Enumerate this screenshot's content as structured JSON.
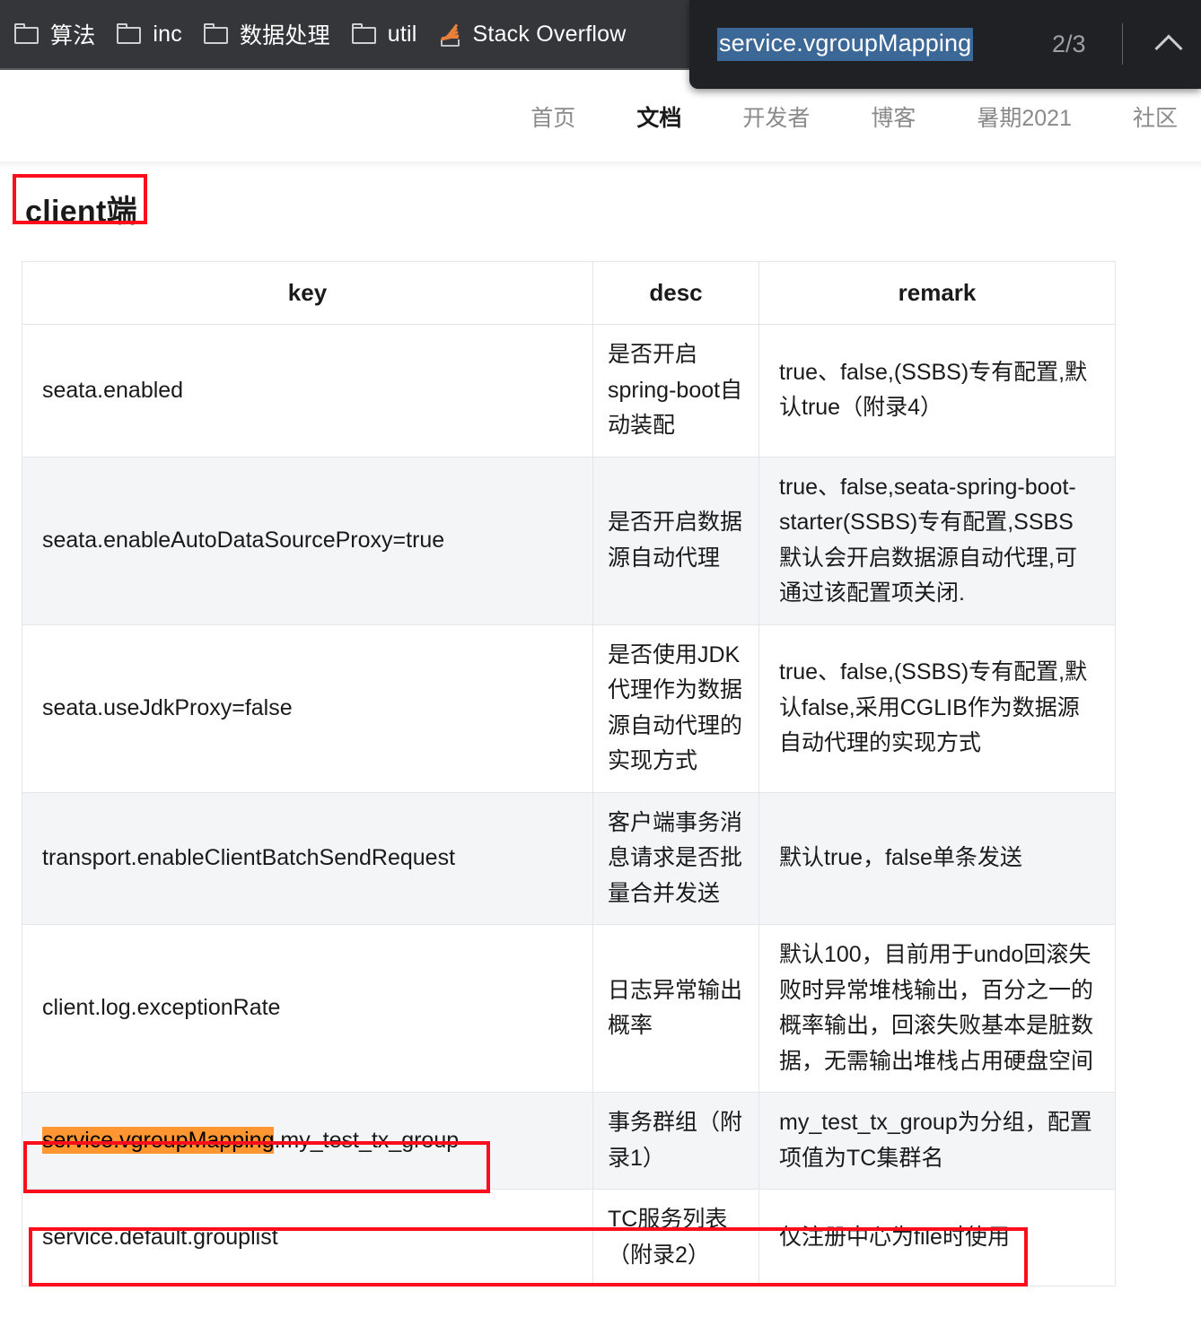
{
  "browser": {
    "bookmarks": [
      {
        "icon": "folder-icon",
        "label": "算法"
      },
      {
        "icon": "folder-icon",
        "label": "inc"
      },
      {
        "icon": "folder-icon",
        "label": "数据处理"
      },
      {
        "icon": "folder-icon",
        "label": "util"
      },
      {
        "icon": "stack-overflow-icon",
        "label": "Stack Overflow"
      }
    ],
    "find_bar": {
      "query": "service.vgroupMapping",
      "match_count": "2/3",
      "prev_icon": "chevron-up-icon"
    }
  },
  "site_nav": {
    "items": [
      {
        "label": "首页",
        "active": false
      },
      {
        "label": "文档",
        "active": true
      },
      {
        "label": "开发者",
        "active": false
      },
      {
        "label": "博客",
        "active": false
      },
      {
        "label": "暑期2021",
        "active": false
      },
      {
        "label": "社区",
        "active": false
      }
    ]
  },
  "page": {
    "heading": "client端",
    "table": {
      "headers": [
        "key",
        "desc",
        "remark"
      ],
      "rows": [
        {
          "key": "seata.enabled",
          "desc": "是否开启spring-boot自动装配",
          "remark": "true、false,(SSBS)专有配置,默认true（附录4）"
        },
        {
          "key": "seata.enableAutoDataSourceProxy=true",
          "desc": "是否开启数据源自动代理",
          "remark": "true、false,seata-spring-boot-starter(SSBS)专有配置,SSBS默认会开启数据源自动代理,可通过该配置项关闭."
        },
        {
          "key": "seata.useJdkProxy=false",
          "desc": "是否使用JDK代理作为数据源自动代理的实现方式",
          "remark": "true、false,(SSBS)专有配置,默认false,采用CGLIB作为数据源自动代理的实现方式"
        },
        {
          "key": "transport.enableClientBatchSendRequest",
          "desc": "客户端事务消息请求是否批量合并发送",
          "remark": "默认true，false单条发送"
        },
        {
          "key": "client.log.exceptionRate",
          "desc": "日志异常输出概率",
          "remark": "默认100，目前用于undo回滚失败时异常堆栈输出，百分之一的概率输出，回滚失败基本是脏数据，无需输出堆栈占用硬盘空间"
        },
        {
          "key_highlight": "service.vgroupMapping",
          "key_rest": ".my_test_tx_group",
          "desc": "事务群组（附录1）",
          "remark": "my_test_tx_group为分组，配置项值为TC集群名"
        },
        {
          "key": "service.default.grouplist",
          "desc": "TC服务列表（附录2）",
          "remark": "仅注册中心为file时使用"
        }
      ]
    }
  },
  "colors": {
    "annotation_red": "#fc0d1b",
    "find_highlight_orange": "#ff9632",
    "find_selection_blue": "#3c6898",
    "bookmarks_bar": "#35363a",
    "find_bar": "#202124"
  }
}
